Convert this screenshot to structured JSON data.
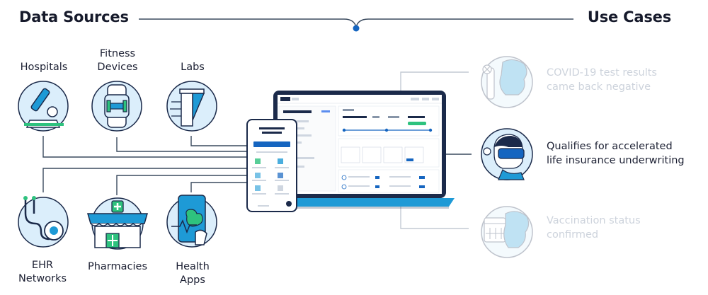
{
  "headings": {
    "left": "Data Sources",
    "right": "Use Cases"
  },
  "sources": {
    "top": [
      {
        "lines": [
          "Hospitals"
        ],
        "icon": "hospital-device-icon"
      },
      {
        "lines": [
          "Fitness",
          "Devices"
        ],
        "icon": "smartwatch-icon"
      },
      {
        "lines": [
          "Labs"
        ],
        "icon": "lab-flask-icon"
      }
    ],
    "bottom": [
      {
        "lines": [
          "EHR",
          "Networks"
        ],
        "icon": "stethoscope-icon"
      },
      {
        "lines": [
          "Pharmacies"
        ],
        "icon": "pharmacy-storefront-icon"
      },
      {
        "lines": [
          "Health",
          "Apps"
        ],
        "icon": "phone-app-icon"
      }
    ]
  },
  "use_cases": [
    {
      "lines": [
        "COVID-19 test results",
        "came back negative"
      ],
      "state": "faded",
      "icon": "test-tube-person-icon"
    },
    {
      "lines": [
        "Qualifies for accelerated",
        "life insurance underwriting"
      ],
      "state": "active",
      "icon": "person-vr-headset-icon"
    },
    {
      "lines": [
        "Vaccination status",
        "confirmed"
      ],
      "state": "faded",
      "icon": "calendar-person-icon"
    }
  ],
  "colors": {
    "accent": "#1565c0",
    "icon_fill": "#dbeefb",
    "line": "#3a4a5e",
    "faded": "#cdd3dc",
    "laptop_base": "#1e9ad6",
    "green": "#2ec27e"
  },
  "center_devices": [
    "laptop-dashboard",
    "phone-questionnaire"
  ]
}
